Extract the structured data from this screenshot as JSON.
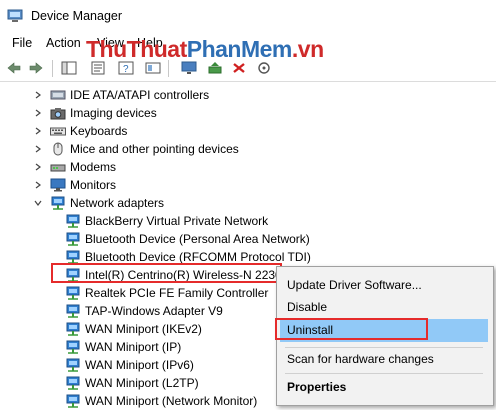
{
  "window": {
    "title": "Device Manager"
  },
  "menu": [
    "File",
    "Action",
    "View",
    "Help"
  ],
  "watermark": {
    "part1": "ThuThuat",
    "part2": "PhanMem",
    "part3": ".vn"
  },
  "tree": [
    {
      "label": "IDE ATA/ATAPI controllers",
      "expanded": false,
      "icon": "ide-controller-icon"
    },
    {
      "label": "Imaging devices",
      "expanded": false,
      "icon": "camera-icon"
    },
    {
      "label": "Keyboards",
      "expanded": false,
      "icon": "keyboard-icon"
    },
    {
      "label": "Mice and other pointing devices",
      "expanded": false,
      "icon": "mouse-icon"
    },
    {
      "label": "Modems",
      "expanded": false,
      "icon": "modem-icon"
    },
    {
      "label": "Monitors",
      "expanded": false,
      "icon": "monitor-icon"
    },
    {
      "label": "Network adapters",
      "expanded": true,
      "icon": "network-adapter-icon"
    }
  ],
  "adapters": [
    "BlackBerry Virtual Private Network",
    "Bluetooth Device (Personal Area Network)",
    "Bluetooth Device (RFCOMM Protocol TDI)",
    "Intel(R) Centrino(R) Wireless-N 2230",
    "Realtek PCIe FE Family Controller",
    "TAP-Windows Adapter V9",
    "WAN Miniport (IKEv2)",
    "WAN Miniport (IP)",
    "WAN Miniport (IPv6)",
    "WAN Miniport (L2TP)",
    "WAN Miniport (Network Monitor)"
  ],
  "context_menu": {
    "update": "Update Driver Software...",
    "disable": "Disable",
    "uninstall": "Uninstall",
    "scan": "Scan for hardware changes",
    "properties": "Properties"
  },
  "colors": {
    "selection": "#91c9f7",
    "highlight_border": "#e52b2b",
    "net_icon": "#2f7fd0"
  }
}
